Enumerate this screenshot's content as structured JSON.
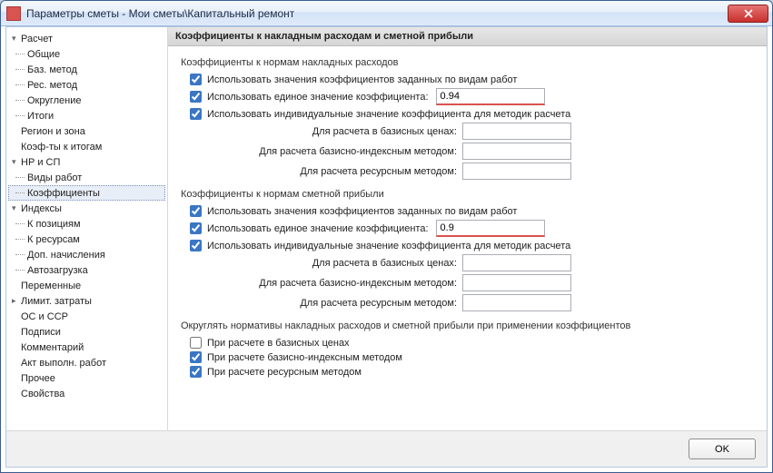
{
  "window": {
    "title": "Параметры сметы - Мои сметы\\Капитальный ремонт"
  },
  "sidebar": {
    "items": [
      {
        "label": "Расчет",
        "level": 0,
        "expand": "▾"
      },
      {
        "label": "Общие",
        "level": 1
      },
      {
        "label": "Баз. метод",
        "level": 1
      },
      {
        "label": "Рес. метод",
        "level": 1
      },
      {
        "label": "Округление",
        "level": 1
      },
      {
        "label": "Итоги",
        "level": 1
      },
      {
        "label": "Регион и зона",
        "level": 0
      },
      {
        "label": "Коэф-ты к итогам",
        "level": 0
      },
      {
        "label": "НР и СП",
        "level": 0,
        "expand": "▾"
      },
      {
        "label": "Виды работ",
        "level": 1
      },
      {
        "label": "Коэффициенты",
        "level": 1,
        "selected": true
      },
      {
        "label": "Индексы",
        "level": 0,
        "expand": "▾"
      },
      {
        "label": "К позициям",
        "level": 1
      },
      {
        "label": "К ресурсам",
        "level": 1
      },
      {
        "label": "Доп. начисления",
        "level": 1
      },
      {
        "label": "Автозагрузка",
        "level": 1
      },
      {
        "label": "Переменные",
        "level": 0
      },
      {
        "label": "Лимит. затраты",
        "level": 0,
        "expand": "▸"
      },
      {
        "label": "ОС и ССР",
        "level": 0
      },
      {
        "label": "Подписи",
        "level": 0
      },
      {
        "label": "Комментарий",
        "level": 0
      },
      {
        "label": "Акт выполн. работ",
        "level": 0
      },
      {
        "label": "Прочее",
        "level": 0
      },
      {
        "label": "Свойства",
        "level": 0
      }
    ]
  },
  "content": {
    "header": "Коэффициенты к накладным расходам и сметной прибыли",
    "group1": {
      "title": "Коэффициенты к нормам накладных расходов",
      "cb_vidy": "Использовать значения коэффициентов заданных по видам работ",
      "cb_edin": "Использовать единое значение коэффициента:",
      "edin_val": "0.94",
      "cb_indiv": "Использовать индивидуальные значение коэффициента для методик расчета",
      "r_basis": "Для расчета в базисных ценах:",
      "r_basidx": "Для расчета базисно-индексным методом:",
      "r_res": "Для расчета ресурсным методом:"
    },
    "group2": {
      "title": "Коэффициенты к нормам сметной прибыли",
      "cb_vidy": "Использовать значения коэффициентов заданных по видам работ",
      "cb_edin": "Использовать единое значение коэффициента:",
      "edin_val": "0.9",
      "cb_indiv": "Использовать индивидуальные значение коэффициента для методик расчета",
      "r_basis": "Для расчета в базисных ценах:",
      "r_basidx": "Для расчета базисно-индексным методом:",
      "r_res": "Для расчета ресурсным методом:"
    },
    "group3": {
      "title": "Округлять нормативы накладных расходов и сметной прибыли при применении коэффициентов",
      "cb_basis": "При расчете в базисных ценах",
      "cb_basidx": "При расчете базисно-индексным методом",
      "cb_res": "При расчете ресурсным методом"
    }
  },
  "footer": {
    "ok": "OK"
  }
}
